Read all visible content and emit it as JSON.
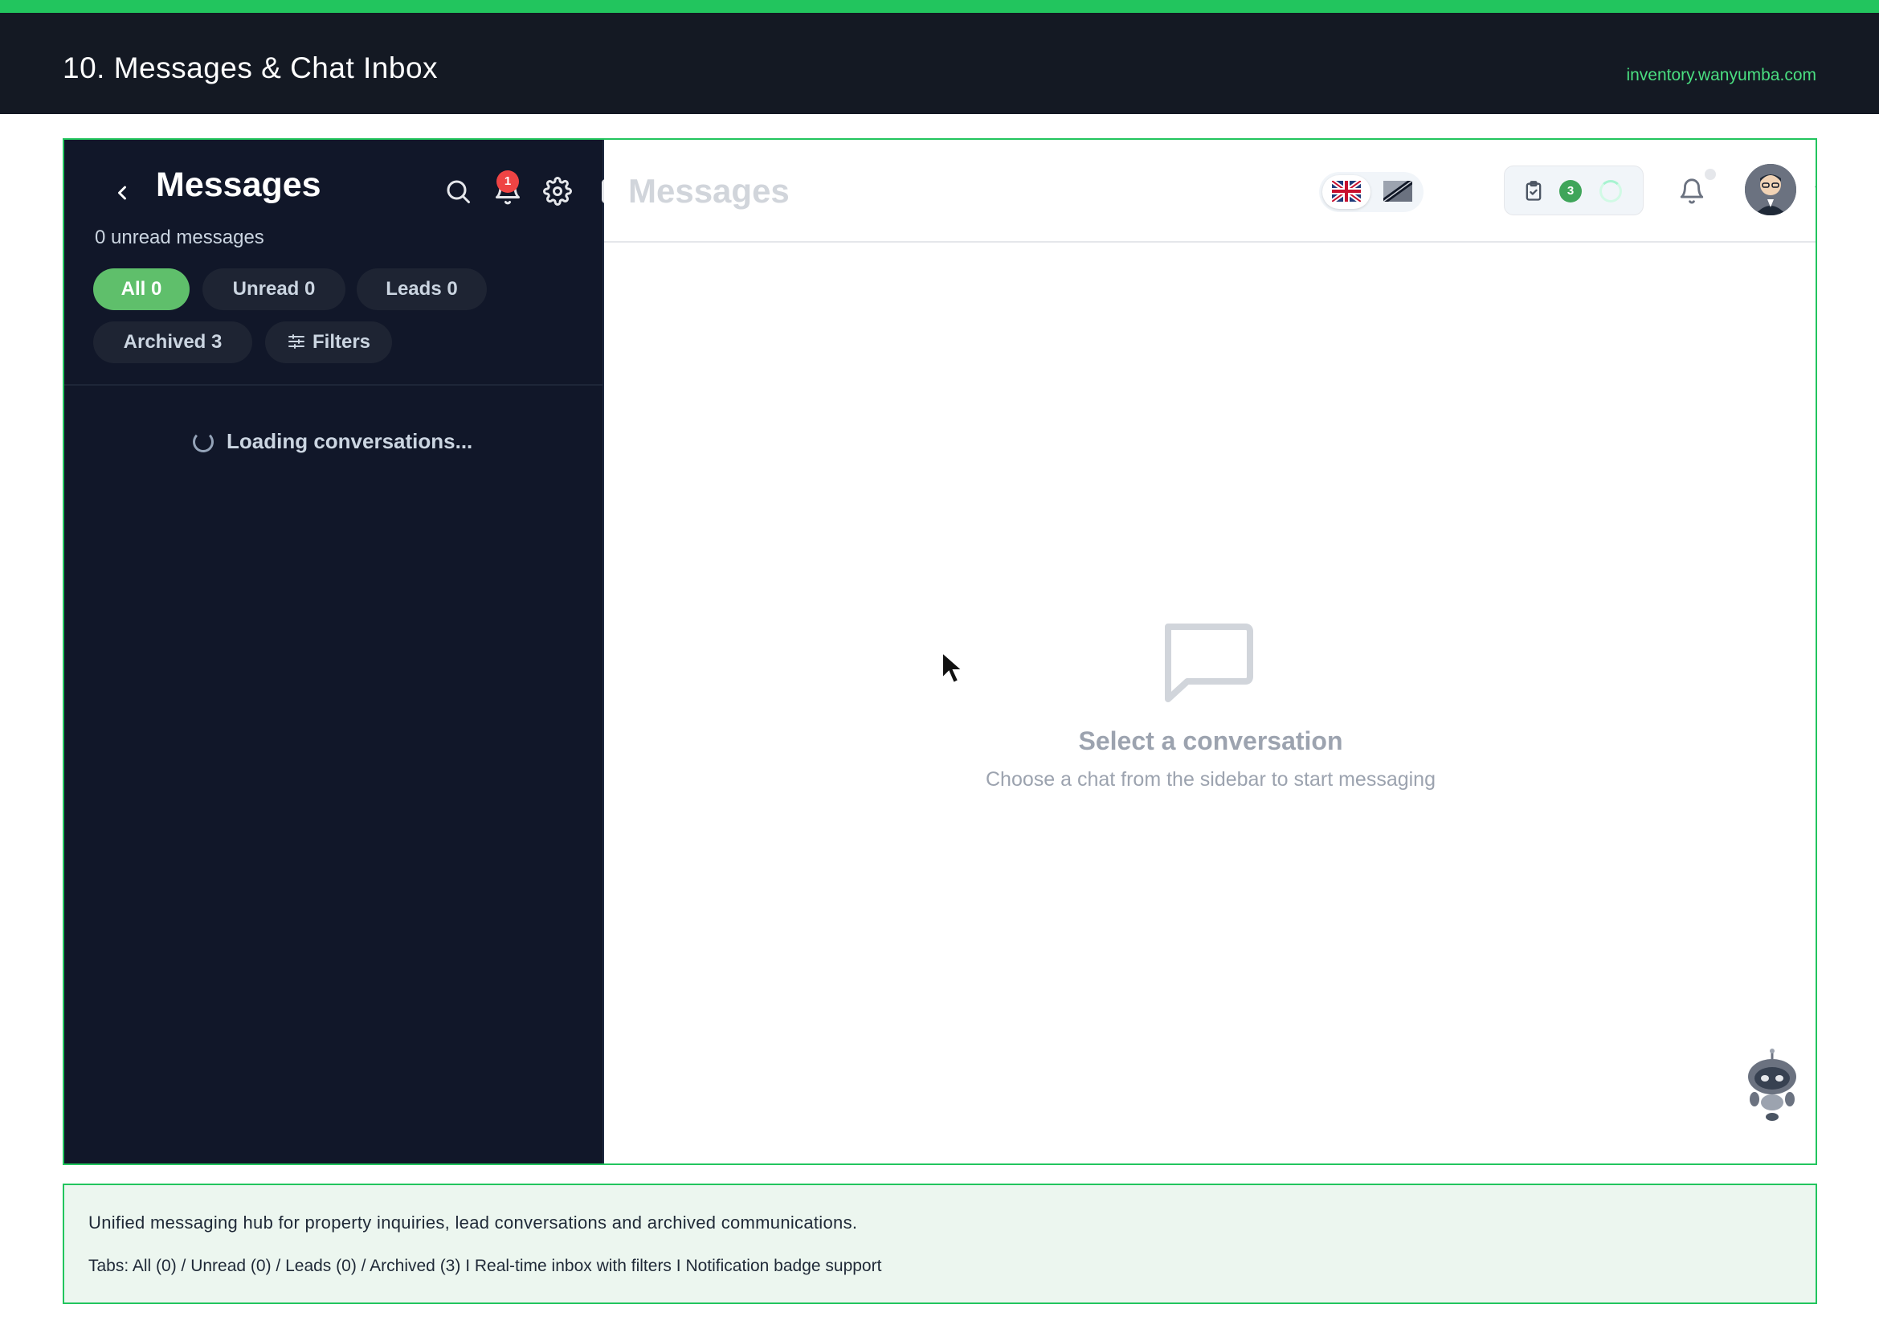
{
  "slide": {
    "title": "10. Messages & Chat Inbox",
    "domain": "inventory.wanyumba.com"
  },
  "sidebar": {
    "title": "Messages",
    "notification_count": "1",
    "unread_text": "0 unread messages",
    "tabs": [
      {
        "label": "All 0",
        "active": true
      },
      {
        "label": "Unread 0",
        "active": false
      },
      {
        "label": "Leads 0",
        "active": false
      },
      {
        "label": "Archived 3",
        "active": false
      },
      {
        "label": "Filters",
        "active": false
      }
    ],
    "loading_text": "Loading conversations..."
  },
  "main": {
    "title": "Messages",
    "task_count": "3",
    "empty_title": "Select a conversation",
    "empty_subtitle": "Choose a chat from the sidebar to start messaging"
  },
  "note": {
    "line1": "Unified messaging hub for property inquiries, lead conversations and archived communications.",
    "line2": "Tabs: All (0) / Unread (0) / Leads (0) / Archived (3)  I  Real-time inbox with filters  I  Notification badge support"
  },
  "colors": {
    "accent": "#22c55e",
    "sidebar_bg": "#111729",
    "header_bg": "#141923",
    "active_tab": "#5fbf6b",
    "badge_red": "#ef4444"
  },
  "icons": [
    "chevron-left-icon",
    "search-icon",
    "bell-icon",
    "gear-icon",
    "sidebar-collapse-icon",
    "sliders-icon",
    "chat-bubble-icon",
    "clipboard-icon",
    "chevron-down-icon",
    "robot-icon"
  ]
}
